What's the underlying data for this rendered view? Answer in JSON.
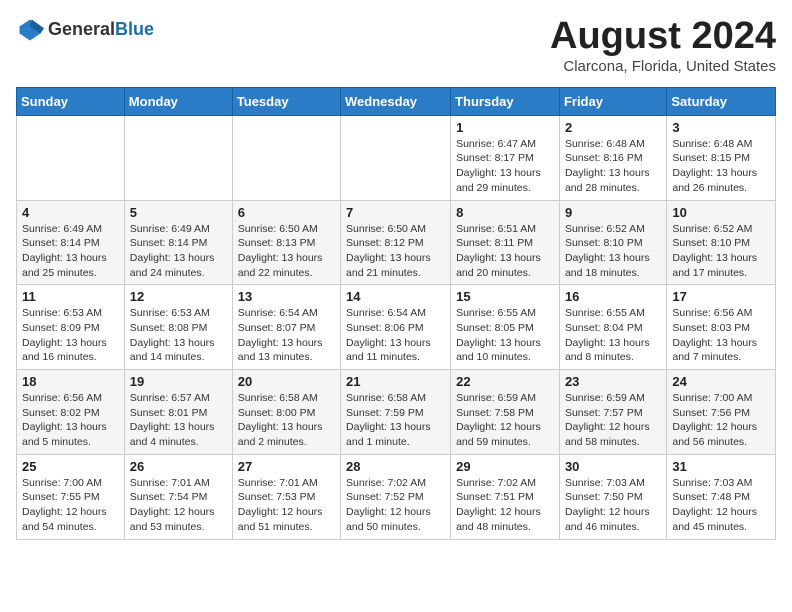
{
  "header": {
    "logo_line1": "General",
    "logo_line2": "Blue",
    "month": "August 2024",
    "location": "Clarcona, Florida, United States"
  },
  "days_of_week": [
    "Sunday",
    "Monday",
    "Tuesday",
    "Wednesday",
    "Thursday",
    "Friday",
    "Saturday"
  ],
  "weeks": [
    [
      {
        "day": "",
        "info": ""
      },
      {
        "day": "",
        "info": ""
      },
      {
        "day": "",
        "info": ""
      },
      {
        "day": "",
        "info": ""
      },
      {
        "day": "1",
        "info": "Sunrise: 6:47 AM\nSunset: 8:17 PM\nDaylight: 13 hours\nand 29 minutes."
      },
      {
        "day": "2",
        "info": "Sunrise: 6:48 AM\nSunset: 8:16 PM\nDaylight: 13 hours\nand 28 minutes."
      },
      {
        "day": "3",
        "info": "Sunrise: 6:48 AM\nSunset: 8:15 PM\nDaylight: 13 hours\nand 26 minutes."
      }
    ],
    [
      {
        "day": "4",
        "info": "Sunrise: 6:49 AM\nSunset: 8:14 PM\nDaylight: 13 hours\nand 25 minutes."
      },
      {
        "day": "5",
        "info": "Sunrise: 6:49 AM\nSunset: 8:14 PM\nDaylight: 13 hours\nand 24 minutes."
      },
      {
        "day": "6",
        "info": "Sunrise: 6:50 AM\nSunset: 8:13 PM\nDaylight: 13 hours\nand 22 minutes."
      },
      {
        "day": "7",
        "info": "Sunrise: 6:50 AM\nSunset: 8:12 PM\nDaylight: 13 hours\nand 21 minutes."
      },
      {
        "day": "8",
        "info": "Sunrise: 6:51 AM\nSunset: 8:11 PM\nDaylight: 13 hours\nand 20 minutes."
      },
      {
        "day": "9",
        "info": "Sunrise: 6:52 AM\nSunset: 8:10 PM\nDaylight: 13 hours\nand 18 minutes."
      },
      {
        "day": "10",
        "info": "Sunrise: 6:52 AM\nSunset: 8:10 PM\nDaylight: 13 hours\nand 17 minutes."
      }
    ],
    [
      {
        "day": "11",
        "info": "Sunrise: 6:53 AM\nSunset: 8:09 PM\nDaylight: 13 hours\nand 16 minutes."
      },
      {
        "day": "12",
        "info": "Sunrise: 6:53 AM\nSunset: 8:08 PM\nDaylight: 13 hours\nand 14 minutes."
      },
      {
        "day": "13",
        "info": "Sunrise: 6:54 AM\nSunset: 8:07 PM\nDaylight: 13 hours\nand 13 minutes."
      },
      {
        "day": "14",
        "info": "Sunrise: 6:54 AM\nSunset: 8:06 PM\nDaylight: 13 hours\nand 11 minutes."
      },
      {
        "day": "15",
        "info": "Sunrise: 6:55 AM\nSunset: 8:05 PM\nDaylight: 13 hours\nand 10 minutes."
      },
      {
        "day": "16",
        "info": "Sunrise: 6:55 AM\nSunset: 8:04 PM\nDaylight: 13 hours\nand 8 minutes."
      },
      {
        "day": "17",
        "info": "Sunrise: 6:56 AM\nSunset: 8:03 PM\nDaylight: 13 hours\nand 7 minutes."
      }
    ],
    [
      {
        "day": "18",
        "info": "Sunrise: 6:56 AM\nSunset: 8:02 PM\nDaylight: 13 hours\nand 5 minutes."
      },
      {
        "day": "19",
        "info": "Sunrise: 6:57 AM\nSunset: 8:01 PM\nDaylight: 13 hours\nand 4 minutes."
      },
      {
        "day": "20",
        "info": "Sunrise: 6:58 AM\nSunset: 8:00 PM\nDaylight: 13 hours\nand 2 minutes."
      },
      {
        "day": "21",
        "info": "Sunrise: 6:58 AM\nSunset: 7:59 PM\nDaylight: 13 hours\nand 1 minute."
      },
      {
        "day": "22",
        "info": "Sunrise: 6:59 AM\nSunset: 7:58 PM\nDaylight: 12 hours\nand 59 minutes."
      },
      {
        "day": "23",
        "info": "Sunrise: 6:59 AM\nSunset: 7:57 PM\nDaylight: 12 hours\nand 58 minutes."
      },
      {
        "day": "24",
        "info": "Sunrise: 7:00 AM\nSunset: 7:56 PM\nDaylight: 12 hours\nand 56 minutes."
      }
    ],
    [
      {
        "day": "25",
        "info": "Sunrise: 7:00 AM\nSunset: 7:55 PM\nDaylight: 12 hours\nand 54 minutes."
      },
      {
        "day": "26",
        "info": "Sunrise: 7:01 AM\nSunset: 7:54 PM\nDaylight: 12 hours\nand 53 minutes."
      },
      {
        "day": "27",
        "info": "Sunrise: 7:01 AM\nSunset: 7:53 PM\nDaylight: 12 hours\nand 51 minutes."
      },
      {
        "day": "28",
        "info": "Sunrise: 7:02 AM\nSunset: 7:52 PM\nDaylight: 12 hours\nand 50 minutes."
      },
      {
        "day": "29",
        "info": "Sunrise: 7:02 AM\nSunset: 7:51 PM\nDaylight: 12 hours\nand 48 minutes."
      },
      {
        "day": "30",
        "info": "Sunrise: 7:03 AM\nSunset: 7:50 PM\nDaylight: 12 hours\nand 46 minutes."
      },
      {
        "day": "31",
        "info": "Sunrise: 7:03 AM\nSunset: 7:48 PM\nDaylight: 12 hours\nand 45 minutes."
      }
    ]
  ]
}
